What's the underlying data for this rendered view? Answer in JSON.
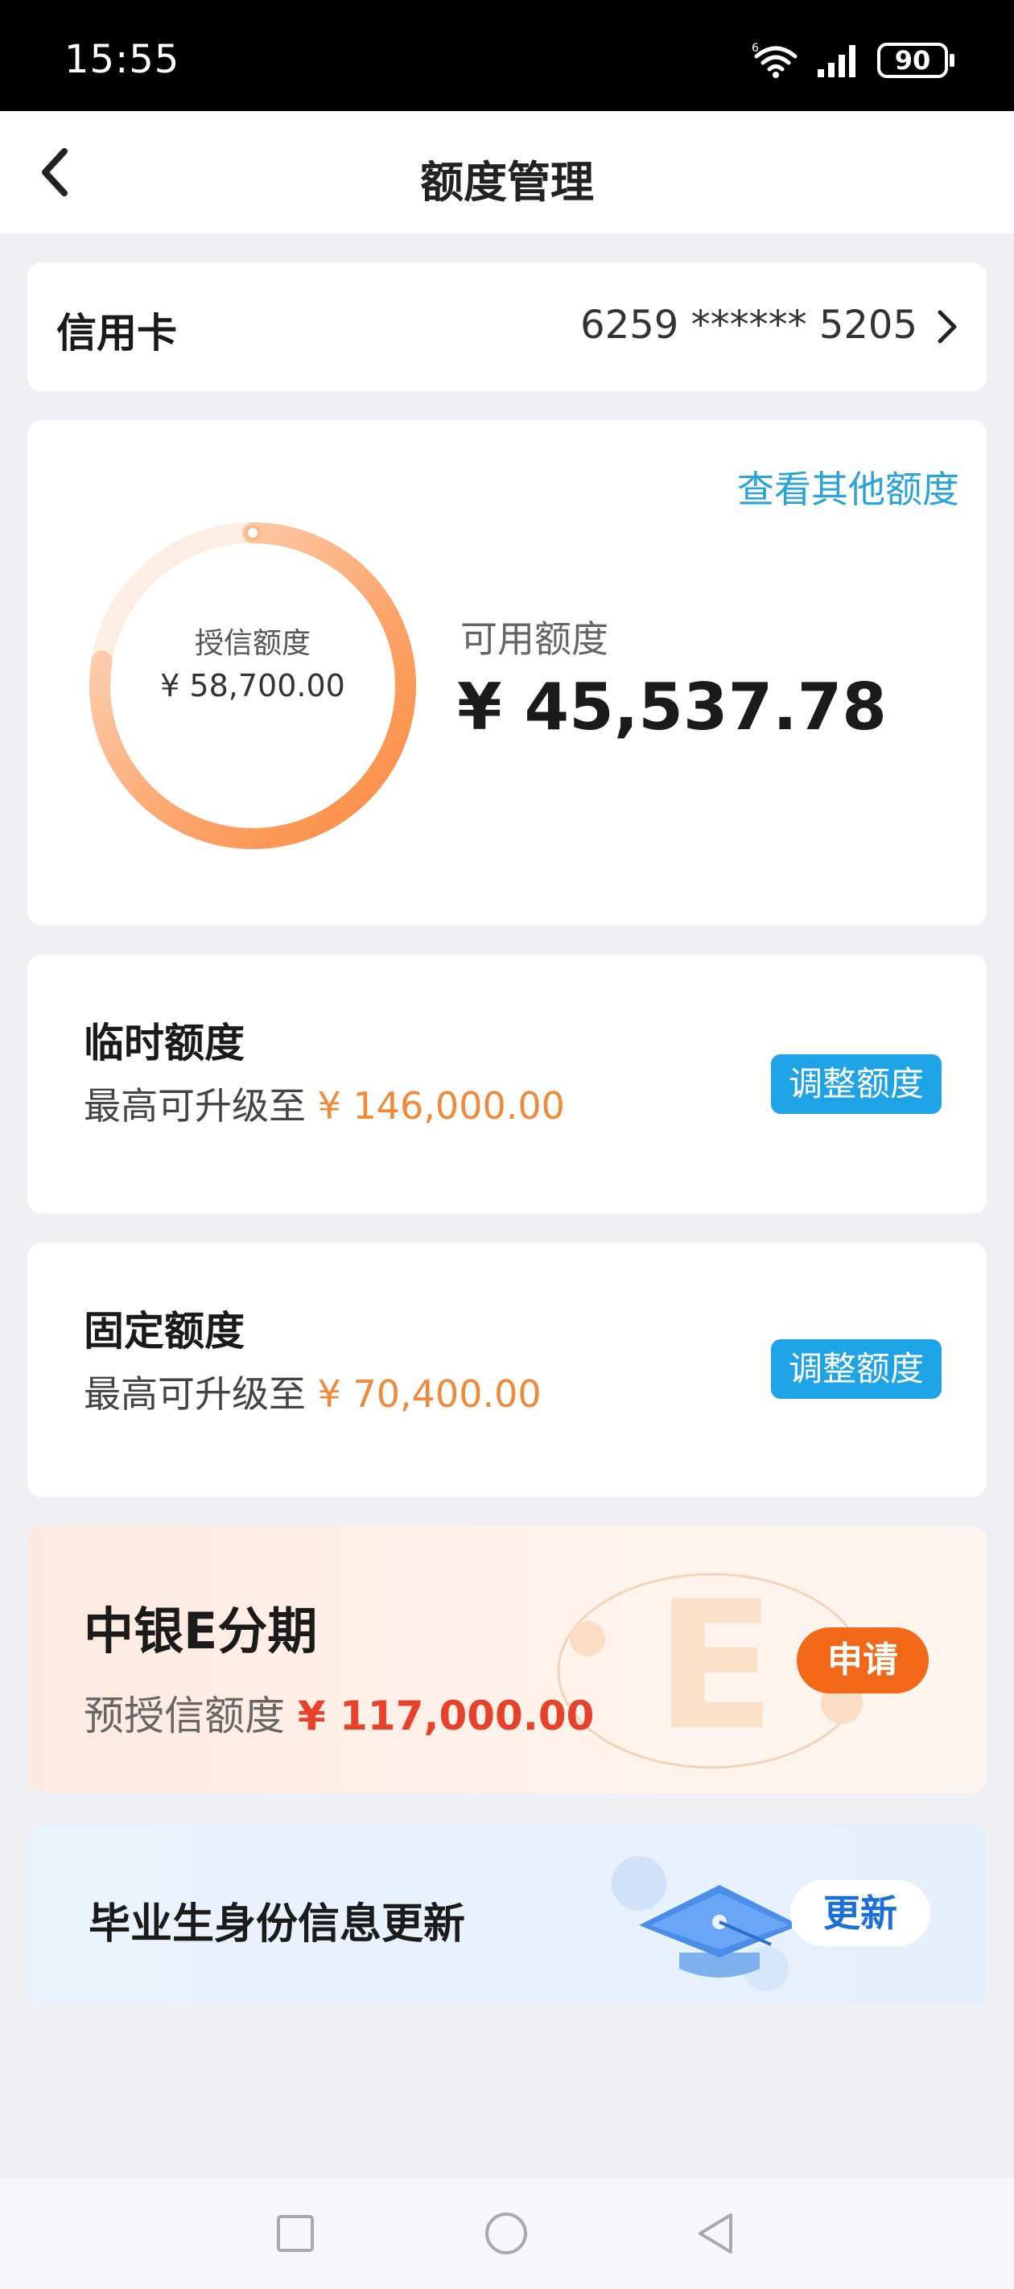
{
  "status_bar": {
    "time": "15:55",
    "battery": "90",
    "wifi_icon": "wifi-icon",
    "signal_icon": "signal-icon"
  },
  "nav": {
    "title": "额度管理",
    "back_icon": "chevron-left-icon"
  },
  "account": {
    "label": "信用卡",
    "number": "6259 ****** 5205",
    "chevron_icon": "chevron-right-icon"
  },
  "limit_overview": {
    "link": "查看其他额度",
    "credit_label": "授信额度",
    "credit_amount": "¥ 58,700.00",
    "available_label": "可用额度",
    "available_amount": "¥ 45,537.78",
    "available_fraction": 0.776,
    "ring_color": "#fb8a3f"
  },
  "temporary_limit": {
    "title": "临时额度",
    "sub_prefix": "最高可升级至",
    "sub_amount": "¥ 146,000.00",
    "button": "调整额度"
  },
  "fixed_limit": {
    "title": "固定额度",
    "sub_prefix": "最高可升级至",
    "sub_amount": "¥ 70,400.00",
    "button": "调整额度"
  },
  "installment": {
    "title": "中银E分期",
    "sub_prefix": "预授信额度",
    "sub_amount": "¥ 117,000.00",
    "button": "申请",
    "deco_icon": "e-letter-icon"
  },
  "graduate": {
    "title": "毕业生身份信息更新",
    "button": "更新",
    "icon": "graduation-cap-icon"
  },
  "system_nav": {
    "recent_icon": "square-icon",
    "home_icon": "circle-icon",
    "back_icon": "triangle-back-icon"
  },
  "colors": {
    "accent_blue": "#1ea3e6",
    "link_blue": "#2aa3d8",
    "orange": "#f08a3a",
    "apply_orange": "#f26818",
    "red_amount": "#e8432a"
  }
}
